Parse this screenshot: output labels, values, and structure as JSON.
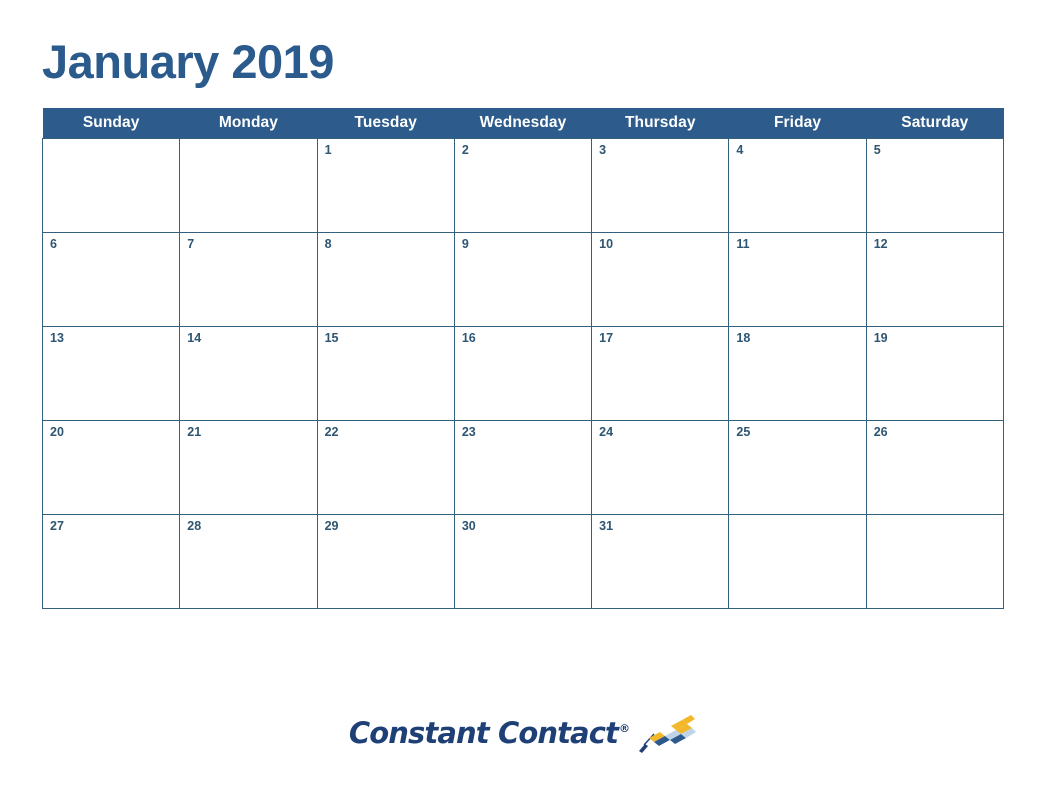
{
  "title": "January 2019",
  "colors": {
    "header_bg": "#2D5B8C",
    "header_text": "#FFFFFF",
    "title_text": "#2B5A8C",
    "grid_line": "#33617D",
    "day_number": "#2E5571",
    "logo_text": "#1F4077",
    "flag_gold": "#F2B829",
    "flag_blue": "#2C5A8C",
    "flag_light_blue": "#BFD4E8",
    "page_bg": "#FFFFFF"
  },
  "calendar": {
    "month": "January",
    "year": "2019",
    "weekday_headers": [
      "Sunday",
      "Monday",
      "Tuesday",
      "Wednesday",
      "Thursday",
      "Friday",
      "Saturday"
    ],
    "weeks": [
      [
        "",
        "",
        "1",
        "2",
        "3",
        "4",
        "5"
      ],
      [
        "6",
        "7",
        "8",
        "9",
        "10",
        "11",
        "12"
      ],
      [
        "13",
        "14",
        "15",
        "16",
        "17",
        "18",
        "19"
      ],
      [
        "20",
        "21",
        "22",
        "23",
        "24",
        "25",
        "26"
      ],
      [
        "27",
        "28",
        "29",
        "30",
        "31",
        "",
        ""
      ]
    ]
  },
  "footer": {
    "logo_text": "Constant Contact",
    "registered_mark": "®",
    "flag_icon": "checkered-flag-icon"
  }
}
